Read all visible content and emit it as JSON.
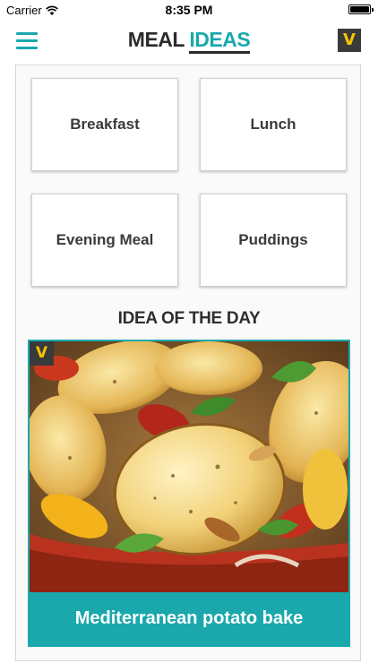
{
  "status_bar": {
    "carrier": "Carrier",
    "time": "8:35 PM"
  },
  "header": {
    "logo_word1": "MEAL",
    "logo_word2": "IDEAS",
    "badge": "V"
  },
  "categories": [
    {
      "label": "Breakfast"
    },
    {
      "label": "Lunch"
    },
    {
      "label": "Evening Meal"
    },
    {
      "label": "Puddings"
    }
  ],
  "idea_of_the_day": {
    "section_title": "IDEA OF THE DAY",
    "badge": "V",
    "title": "Mediterranean potato bake"
  },
  "colors": {
    "accent": "#1aa8ad",
    "badge_bg": "#3a3a3a",
    "badge_text": "#f5c400"
  }
}
